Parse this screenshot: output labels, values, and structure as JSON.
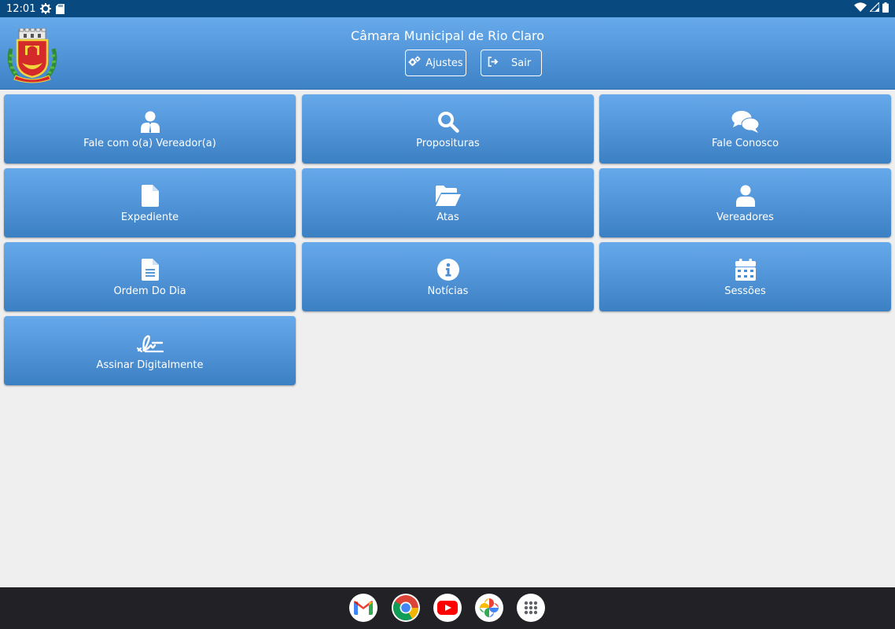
{
  "status_bar": {
    "time": "12:01",
    "icons": [
      "settings-gear-icon",
      "sd-card-icon",
      "wifi-icon",
      "signal-icon",
      "battery-icon"
    ]
  },
  "header": {
    "title": "Câmara Municipal de Rio Claro",
    "logo": "rio-claro-coat-of-arms",
    "buttons": [
      {
        "label": "Ajustes",
        "icon": "cogs-icon"
      },
      {
        "label": "Sair",
        "icon": "sign-out-icon"
      }
    ]
  },
  "menu": {
    "items": [
      {
        "label": "Fale com o(a) Vereador(a)",
        "icon": "user-tie-icon"
      },
      {
        "label": "Proposituras",
        "icon": "search-icon"
      },
      {
        "label": "Fale Conosco",
        "icon": "comments-icon"
      },
      {
        "label": "Expediente",
        "icon": "file-icon"
      },
      {
        "label": "Atas",
        "icon": "folder-open-icon"
      },
      {
        "label": "Vereadores",
        "icon": "user-icon"
      },
      {
        "label": "Ordem Do Dia",
        "icon": "file-text-icon"
      },
      {
        "label": "Notícias",
        "icon": "info-circle-icon"
      },
      {
        "label": "Sessões",
        "icon": "calendar-icon"
      },
      {
        "label": "Assinar Digitalmente",
        "icon": "signature-icon"
      }
    ]
  },
  "nav_bar": {
    "apps": [
      "gmail-icon",
      "chrome-icon",
      "youtube-icon",
      "photos-icon",
      "app-drawer-icon"
    ]
  },
  "colors": {
    "status_bar": "#08497f",
    "tile_top": "#66a9eb",
    "tile_bottom": "#3c80c4",
    "background": "#efefef",
    "nav_bar": "#222226"
  }
}
